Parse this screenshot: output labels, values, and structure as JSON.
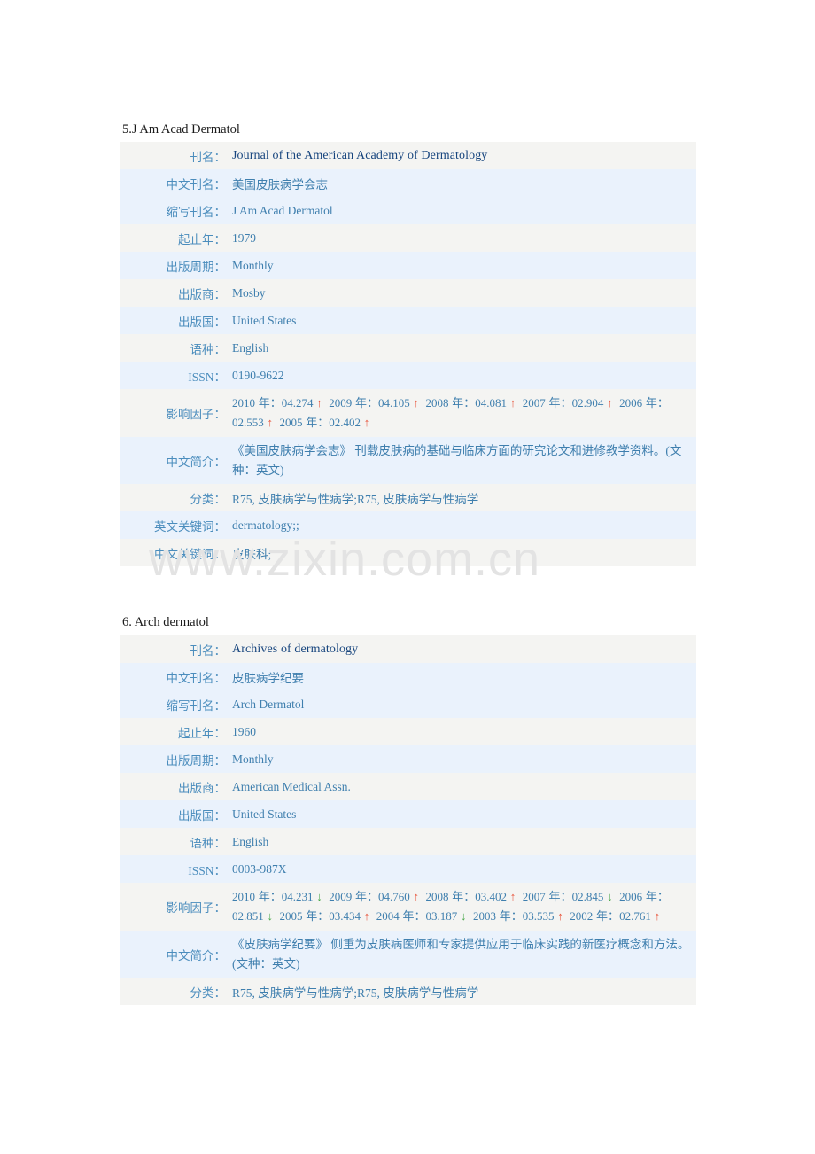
{
  "watermark": {
    "text": "www.zixin.com.cn"
  },
  "sections": [
    {
      "heading": "5.J Am Acad Dermatol",
      "rows": {
        "title_label": "刊名：",
        "title_value": "Journal of the American Academy of Dermatology",
        "cn_title_label": "中文刊名：",
        "cn_title_value": "美国皮肤病学会志",
        "abbr_label": "缩写刊名：",
        "abbr_value": "J Am Acad Dermatol",
        "years_label": "起止年：",
        "years_value": "1979",
        "freq_label": "出版周期：",
        "freq_value": "Monthly",
        "publisher_label": "出版商：",
        "publisher_value": "Mosby",
        "country_label": "出版国：",
        "country_value": "United States",
        "language_label": "语种：",
        "language_value": "English",
        "issn_label": "ISSN：",
        "issn_value": "0190-9622",
        "impact_label": "影响因子：",
        "desc_label": "中文简介：",
        "desc_value": "《美国皮肤病学会志》 刊载皮肤病的基础与临床方面的研究论文和进修教学资料。(文种：英文)",
        "class_label": "分类：",
        "class_value": "R75, 皮肤病学与性病学;R75, 皮肤病学与性病学",
        "en_kw_label": "英文关键词：",
        "en_kw_value": "dermatology;;",
        "cn_kw_label": "中文关键词：",
        "cn_kw_value": "皮肤科;"
      },
      "impact_factors": [
        {
          "year": "2010 年：",
          "value": "04.274",
          "trend": "up"
        },
        {
          "year": "2009 年：",
          "value": "04.105",
          "trend": "up"
        },
        {
          "year": "2008 年：",
          "value": "04.081",
          "trend": "up"
        },
        {
          "year": "2007 年：",
          "value": "02.904",
          "trend": "up"
        },
        {
          "year": "2006 年：",
          "value": "02.553",
          "trend": "up"
        },
        {
          "year": "2005 年：",
          "value": "02.402",
          "trend": "up"
        }
      ]
    },
    {
      "heading": "6. Arch dermatol",
      "rows": {
        "title_label": "刊名：",
        "title_value": "Archives of dermatology",
        "cn_title_label": "中文刊名：",
        "cn_title_value": "皮肤病学纪要",
        "abbr_label": "缩写刊名：",
        "abbr_value": "Arch Dermatol",
        "years_label": "起止年：",
        "years_value": "1960",
        "freq_label": "出版周期：",
        "freq_value": "Monthly",
        "publisher_label": "出版商：",
        "publisher_value": "American Medical Assn.",
        "country_label": "出版国：",
        "country_value": "United States",
        "language_label": "语种：",
        "language_value": "English",
        "issn_label": "ISSN：",
        "issn_value": "0003-987X",
        "impact_label": "影响因子：",
        "desc_label": "中文简介：",
        "desc_value": "《皮肤病学纪要》 侧重为皮肤病医师和专家提供应用于临床实践的新医疗概念和方法。(文种：英文)",
        "class_label": "分类：",
        "class_value": "R75, 皮肤病学与性病学;R75, 皮肤病学与性病学"
      },
      "impact_factors": [
        {
          "year": "2010 年：",
          "value": "04.231",
          "trend": "down"
        },
        {
          "year": "2009 年：",
          "value": "04.760",
          "trend": "up"
        },
        {
          "year": "2008 年：",
          "value": "03.402",
          "trend": "up"
        },
        {
          "year": "2007 年：",
          "value": "02.845",
          "trend": "down"
        },
        {
          "year": "2006 年：",
          "value": "02.851",
          "trend": "down"
        },
        {
          "year": "2005 年：",
          "value": "03.434",
          "trend": "up"
        },
        {
          "year": "2004 年：",
          "value": "03.187",
          "trend": "down"
        },
        {
          "year": "2003 年：",
          "value": "03.535",
          "trend": "up"
        },
        {
          "year": "2002 年：",
          "value": "02.761",
          "trend": "up"
        }
      ]
    }
  ],
  "colors": {
    "row_gray": "#f4f4f2",
    "row_blue": "#eaf2fc",
    "label": "#4b8dbd",
    "value": "#3f7fae",
    "title": "#17457e",
    "arrow_up": "#e8553c",
    "arrow_down": "#4aa84a",
    "watermark": "#e3e3e3"
  }
}
